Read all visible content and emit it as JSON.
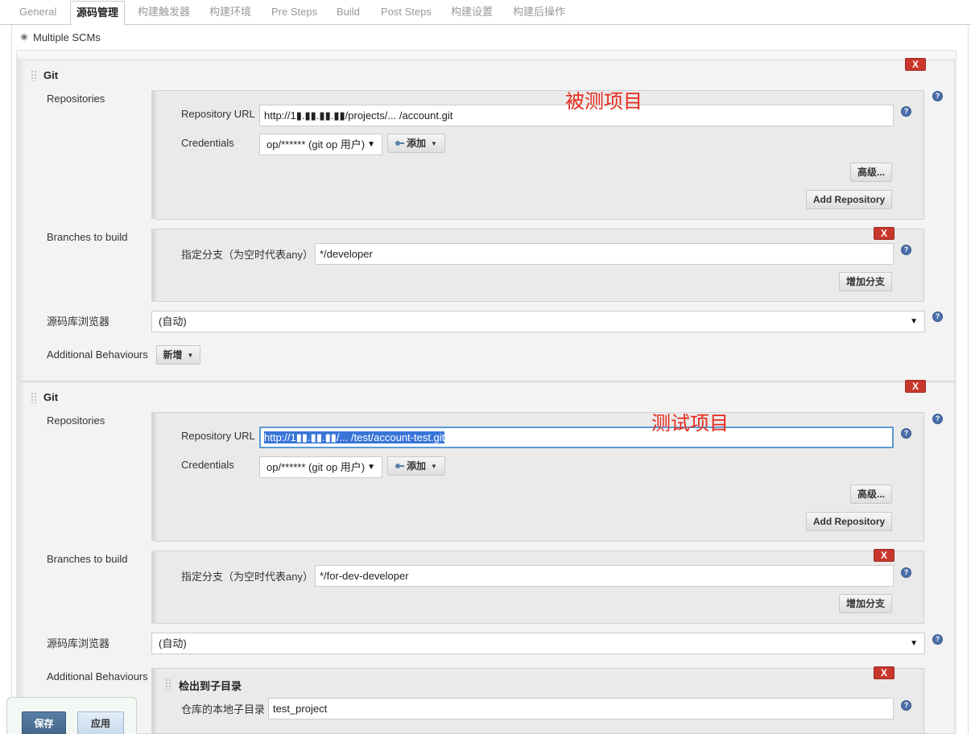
{
  "tabs": [
    {
      "label": "General",
      "active": false
    },
    {
      "label": "源码管理",
      "active": true
    },
    {
      "label": "构建触发器",
      "active": false
    },
    {
      "label": "构建环境",
      "active": false
    },
    {
      "label": "Pre Steps",
      "active": false
    },
    {
      "label": "Build",
      "active": false
    },
    {
      "label": "Post Steps",
      "active": false
    },
    {
      "label": "构建设置",
      "active": false
    },
    {
      "label": "构建后操作",
      "active": false
    }
  ],
  "scm_option": "Multiple SCMs",
  "git_blocks": [
    {
      "title": "Git",
      "delete_label": "X",
      "repositories_label": "Repositories",
      "repo_url_label": "Repository URL",
      "repo_url_value": "http://1▮.▮▮.▮▮.▮▮/projects/... /account.git",
      "credentials_label": "Credentials",
      "credentials_value": "op/****** (git op 用户)",
      "add_button": "添加",
      "advanced_button": "高级...",
      "add_repository_button": "Add Repository",
      "branches_label": "Branches to build",
      "branch_spec_label": "指定分支（为空时代表any）",
      "branch_value": "*/developer",
      "branch_delete_label": "X",
      "add_branch_button": "增加分支",
      "browser_label": "源码库浏览器",
      "browser_value": "(自动)",
      "behaviours_label": "Additional Behaviours",
      "new_button": "新增",
      "annotation": "被测项目"
    },
    {
      "title": "Git",
      "delete_label": "X",
      "repositories_label": "Repositories",
      "repo_url_label": "Repository URL",
      "repo_url_value": "http://1▮▮.▮▮.▮▮/... /test/account-test.git",
      "credentials_label": "Credentials",
      "credentials_value": "op/****** (git op 用户)",
      "add_button": "添加",
      "advanced_button": "高级...",
      "add_repository_button": "Add Repository",
      "branches_label": "Branches to build",
      "branch_spec_label": "指定分支（为空时代表any）",
      "branch_value": "*/for-dev-developer",
      "branch_delete_label": "X",
      "add_branch_button": "增加分支",
      "browser_label": "源码库浏览器",
      "browser_value": "(自动)",
      "behaviours_label": "Additional Behaviours",
      "annotation": "测试项目",
      "behaviour": {
        "title": "检出到子目录",
        "delete_label": "X",
        "subdir_label": "仓库的本地子目录",
        "subdir_value": "test_project"
      }
    }
  ],
  "footer": {
    "save_button": "保存",
    "apply_button": "应用"
  },
  "help_glyph": "?",
  "colors": {
    "delete_red": "#c9372c",
    "annotation_red": "#e8291c",
    "selection_blue": "#3875d7",
    "save_blue": "#4b6f93"
  }
}
